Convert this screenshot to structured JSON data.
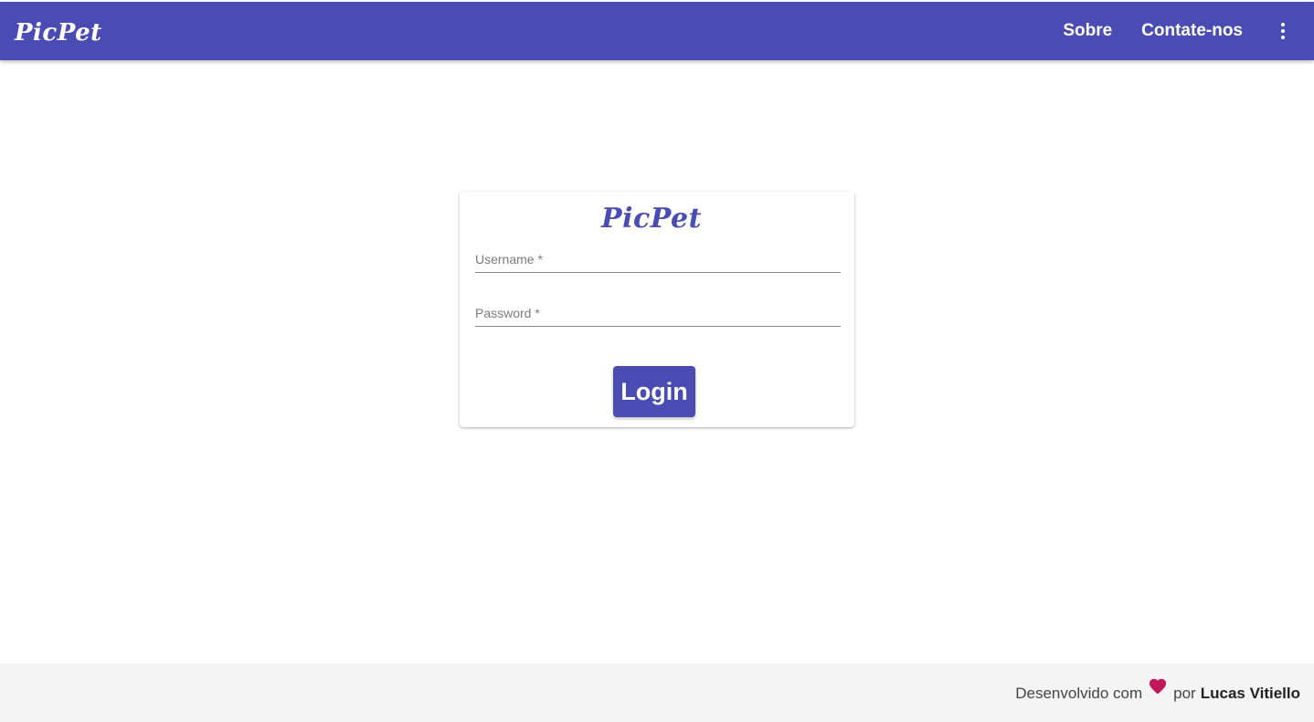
{
  "header": {
    "brand": "PicPet",
    "nav": {
      "sobre": "Sobre",
      "contato": "Contate-nos"
    },
    "menu_icon": "more-vertical-icon"
  },
  "login_card": {
    "logo": "PicPet",
    "username": {
      "label": "Username *",
      "value": ""
    },
    "password": {
      "label": "Password *",
      "value": ""
    },
    "submit_label": "Login"
  },
  "footer": {
    "prefix": "Desenvolvido com",
    "heart_icon": "heart-icon",
    "middle": "por",
    "author": "Lucas Vitiello"
  },
  "colors": {
    "primary": "#4a4cb4",
    "heart": "#c2185b",
    "footer_bg": "#f4f4f4"
  }
}
